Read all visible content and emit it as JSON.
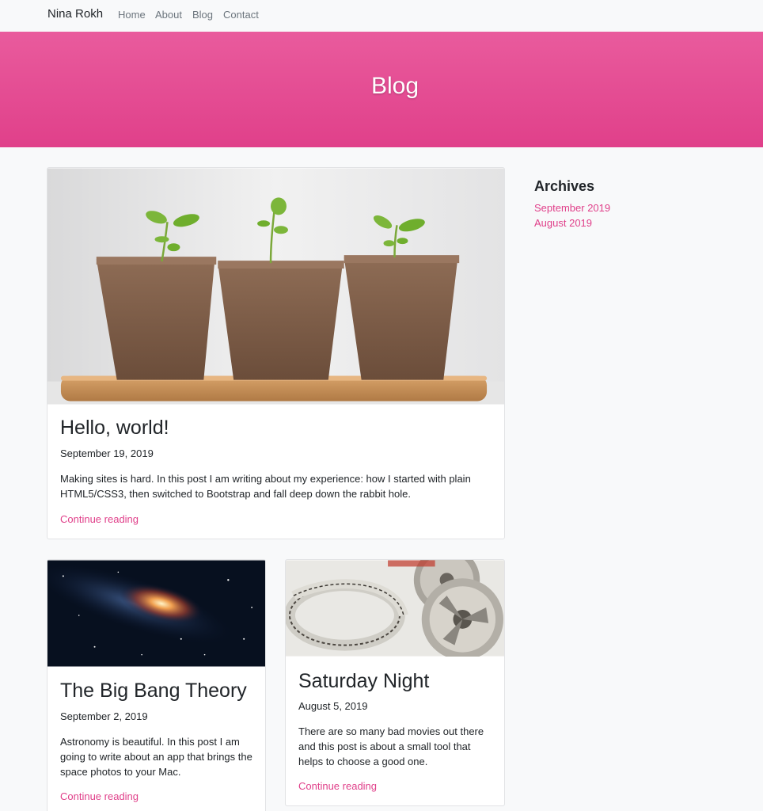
{
  "nav": {
    "brand": "Nina Rokh",
    "links": [
      "Home",
      "About",
      "Blog",
      "Contact"
    ]
  },
  "hero": {
    "title": "Blog"
  },
  "colors": {
    "accent": "#e0408a",
    "hero_top": "#e95b9d",
    "hero_bottom": "#e0408a",
    "background": "#f8f9fa"
  },
  "posts": [
    {
      "image": "seedlings-in-peat-pots-image",
      "title": "Hello, world!",
      "date": "September 19, 2019",
      "excerpt": "Making sites is hard. In this post I am writing about my experience: how I started with plain HTML5/CSS3, then switched to Bootstrap and fall deep down the rabbit hole.",
      "link": "Continue reading"
    },
    {
      "image": "milky-way-galaxy-image",
      "title": "The Big Bang Theory",
      "date": "September 2, 2019",
      "excerpt": "Astronomy is beautiful. In this post I am going to write about an app that brings the space photos to your Mac.",
      "link": "Continue reading"
    },
    {
      "image": "film-reels-image",
      "title": "Saturday Night",
      "date": "August 5, 2019",
      "excerpt": "There are so many bad movies out there and this post is about a small tool that helps to choose a good one.",
      "link": "Continue reading"
    }
  ],
  "sidebar": {
    "heading": "Archives",
    "links": [
      "September 2019",
      "August 2019"
    ]
  }
}
